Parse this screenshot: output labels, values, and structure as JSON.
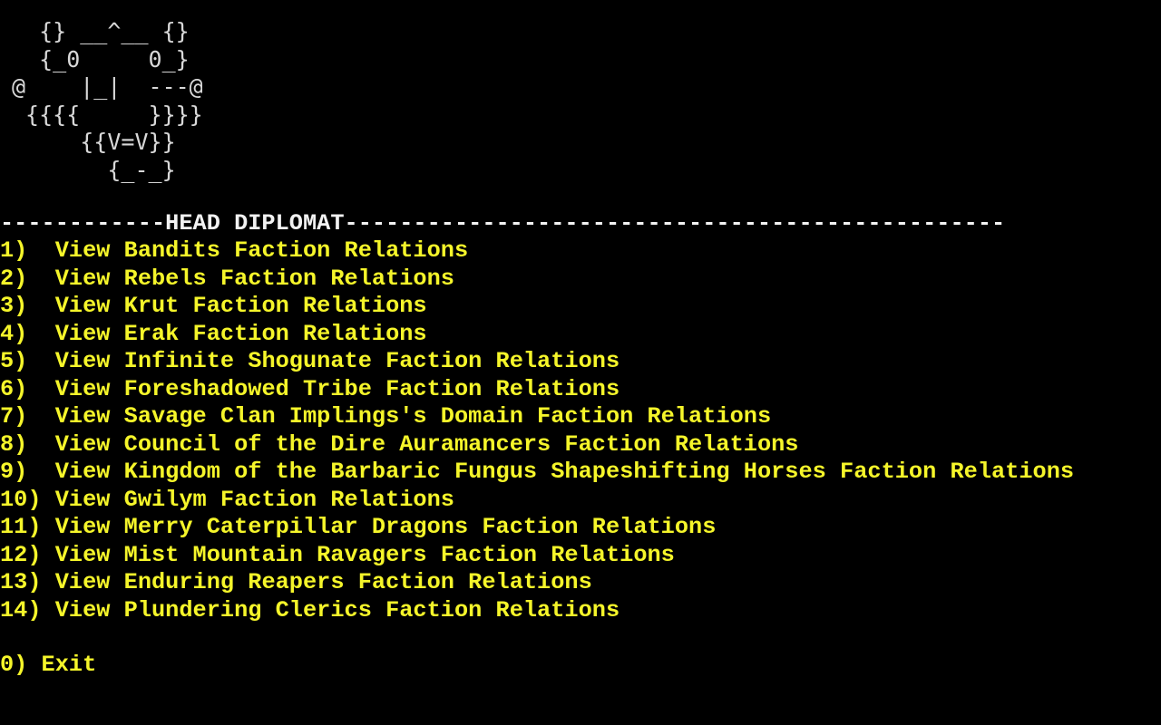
{
  "ascii_art": "  {} __^__ {}\n  {_0     0_}\n@    |_|  ---@\n {{{{     }}}}\n     {{V=V}}\n       {_-_}",
  "header": {
    "text": "------------HEAD DIPLOMAT------------------------------------------------"
  },
  "menu": {
    "items": [
      {
        "number": "1)  ",
        "label": "View Bandits Faction Relations"
      },
      {
        "number": "2)  ",
        "label": "View Rebels Faction Relations"
      },
      {
        "number": "3)  ",
        "label": "View Krut Faction Relations"
      },
      {
        "number": "4)  ",
        "label": "View Erak Faction Relations"
      },
      {
        "number": "5)  ",
        "label": "View Infinite Shogunate Faction Relations"
      },
      {
        "number": "6)  ",
        "label": "View Foreshadowed Tribe Faction Relations"
      },
      {
        "number": "7)  ",
        "label": "View Savage Clan Implings's Domain Faction Relations"
      },
      {
        "number": "8)  ",
        "label": "View Council of the Dire Auramancers Faction Relations"
      },
      {
        "number": "9)  ",
        "label": "View Kingdom of the Barbaric Fungus Shapeshifting Horses Faction Relations"
      },
      {
        "number": "10) ",
        "label": "View Gwilym Faction Relations"
      },
      {
        "number": "11) ",
        "label": "View Merry Caterpillar Dragons Faction Relations"
      },
      {
        "number": "12) ",
        "label": "View Mist Mountain Ravagers Faction Relations"
      },
      {
        "number": "13) ",
        "label": "View Enduring Reapers Faction Relations"
      },
      {
        "number": "14) ",
        "label": "View Plundering Clerics Faction Relations"
      }
    ],
    "exit": {
      "number": "0) ",
      "label": "Exit"
    }
  },
  "colors": {
    "background": "#000000",
    "menu_text": "#f5f52a",
    "header_text": "#f2f2f2",
    "art_text": "#d8d8d8"
  }
}
